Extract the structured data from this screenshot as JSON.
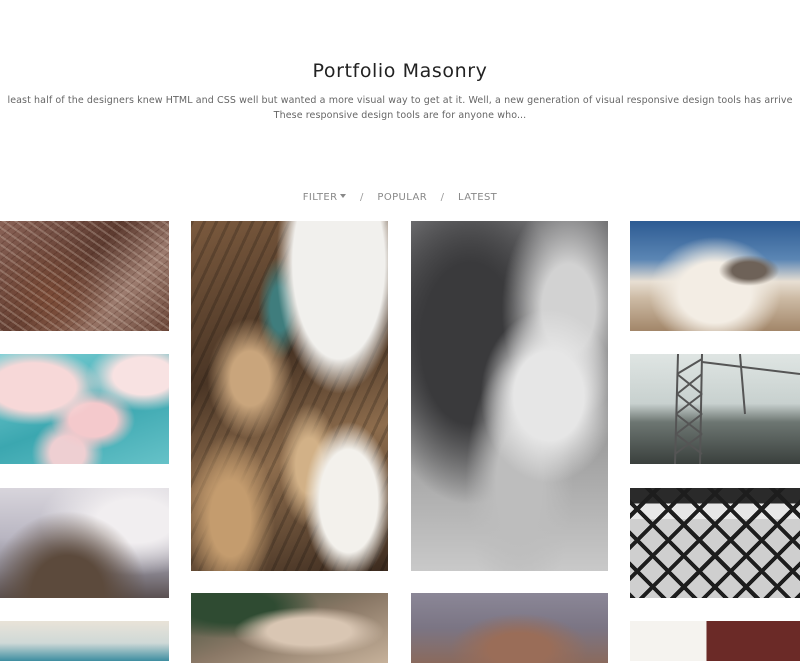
{
  "header": {
    "title": "Portfolio Masonry",
    "description_line1": "least half of the designers knew HTML and CSS well but wanted a more visual way to get at it. Well, a new generation of visual responsive design tools has arrive",
    "description_line2": "These responsive design tools are for anyone who..."
  },
  "filters": {
    "filter_label": "FILTER",
    "separator": "/",
    "popular_label": "POPULAR",
    "latest_label": "LATEST",
    "filter_icon": "caret-down-icon"
  },
  "gallery": {
    "items": [
      {
        "subject": "aerial-city-photo"
      },
      {
        "subject": "abstract-pink-teal-photo"
      },
      {
        "subject": "hazy-aerial-landscape-photo"
      },
      {
        "subject": "sky-horizon-photo"
      },
      {
        "subject": "satellite-terrain-photo"
      },
      {
        "subject": "rocky-ground-photo"
      },
      {
        "subject": "storm-clouds-photo"
      },
      {
        "subject": "canyon-aerial-photo"
      },
      {
        "subject": "mountain-above-clouds-photo"
      },
      {
        "subject": "tower-crane-photo"
      },
      {
        "subject": "steel-structure-photo"
      },
      {
        "subject": "interior-wall-photo"
      }
    ]
  },
  "colors": {
    "background": "#ffffff",
    "title_text": "#222222",
    "body_text": "#666666",
    "filter_text": "#888888"
  }
}
